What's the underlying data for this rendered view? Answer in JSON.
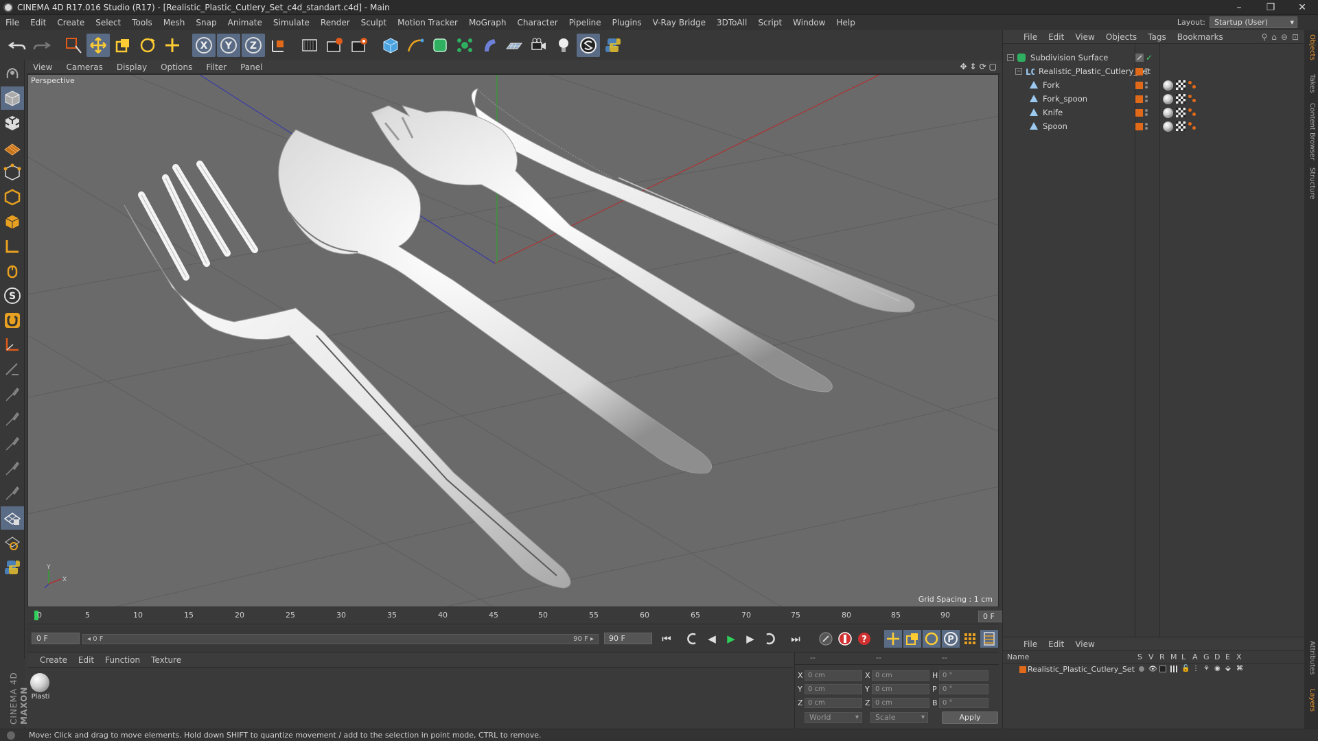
{
  "window": {
    "title": "CINEMA 4D R17.016 Studio (R17) - [Realistic_Plastic_Cutlery_Set_c4d_standart.c4d] - Main",
    "minimize": "–",
    "maximize": "❐",
    "close": "✕"
  },
  "menu": [
    "File",
    "Edit",
    "Create",
    "Select",
    "Tools",
    "Mesh",
    "Snap",
    "Animate",
    "Simulate",
    "Render",
    "Sculpt",
    "Motion Tracker",
    "MoGraph",
    "Character",
    "Pipeline",
    "Plugins",
    "V-Ray Bridge",
    "3DToAll",
    "Script",
    "Window",
    "Help"
  ],
  "layout": {
    "label": "Layout:",
    "value": "Startup (User)"
  },
  "viewport": {
    "menu": [
      "View",
      "Cameras",
      "Display",
      "Options",
      "Filter",
      "Panel"
    ],
    "camera_label": "Perspective",
    "grid_spacing": "Grid Spacing : 1 cm",
    "axis_y": "Y",
    "axis_x": "X"
  },
  "timeline": {
    "ticks": [
      "0",
      "5",
      "10",
      "15",
      "20",
      "25",
      "30",
      "35",
      "40",
      "45",
      "50",
      "55",
      "60",
      "65",
      "70",
      "75",
      "80",
      "85",
      "90"
    ],
    "current_frame": "0 F"
  },
  "transport": {
    "start_field": "0 F",
    "range_start": "◂ 0 F",
    "range_end": "90 F ▸",
    "end_field": "90 F"
  },
  "material_panel": {
    "menu": [
      "Create",
      "Edit",
      "Function",
      "Texture"
    ],
    "materials": [
      {
        "name": "Plasti"
      }
    ]
  },
  "coordinates": {
    "header": [
      "--",
      "--",
      "--"
    ],
    "rows": [
      {
        "axis1": "X",
        "pos": "0 cm",
        "axis2": "X",
        "size": "0 cm",
        "axis3": "H",
        "rot": "0 °"
      },
      {
        "axis1": "Y",
        "pos": "0 cm",
        "axis2": "Y",
        "size": "0 cm",
        "axis3": "P",
        "rot": "0 °"
      },
      {
        "axis1": "Z",
        "pos": "0 cm",
        "axis2": "Z",
        "size": "0 cm",
        "axis3": "B",
        "rot": "0 °"
      }
    ],
    "mode": "World",
    "scale": "Scale",
    "apply": "Apply"
  },
  "object_manager": {
    "menu": [
      "File",
      "Edit",
      "View",
      "Objects",
      "Tags",
      "Bookmarks"
    ],
    "objects": [
      {
        "name": "Subdivision Surface"
      },
      {
        "name": "Realistic_Plastic_Cutlery_Set"
      },
      {
        "name": "Fork"
      },
      {
        "name": "Fork_spoon"
      },
      {
        "name": "Knife"
      },
      {
        "name": "Spoon"
      }
    ]
  },
  "layer_manager": {
    "menu": [
      "File",
      "Edit",
      "View"
    ],
    "header": {
      "name": "Name",
      "cols": [
        "S",
        "V",
        "R",
        "M",
        "L",
        "A",
        "G",
        "D",
        "E",
        "X"
      ]
    },
    "layers": [
      {
        "name": "Realistic_Plastic_Cutlery_Set"
      }
    ]
  },
  "right_tabs": [
    "Objects",
    "Takes",
    "Content Browser",
    "Structure",
    "Attributes",
    "Layers"
  ],
  "logo": {
    "brand": "MAXON",
    "product": "CINEMA 4D"
  },
  "status": "Move: Click and drag to move elements. Hold down SHIFT to quantize movement / add to the selection in point mode, CTRL to remove.",
  "colors": {
    "accent_orange": "#e06a1a",
    "active_tool": "#5a6b85",
    "playhead": "#2fd05a",
    "viewport_bg": "#6a6a6a"
  }
}
